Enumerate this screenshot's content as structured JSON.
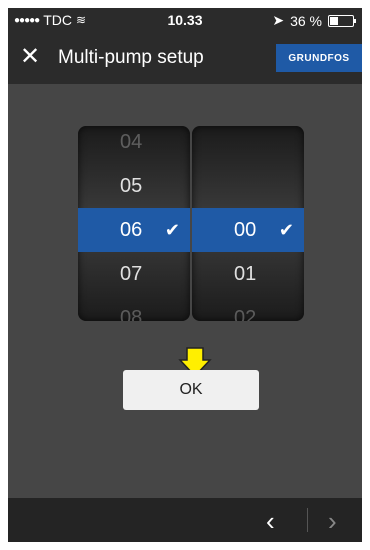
{
  "status_bar": {
    "carrier": "TDC",
    "time": "10.33",
    "battery": "36 %"
  },
  "header": {
    "close_icon": "close-icon",
    "title": "Multi-pump setup",
    "brand": "GRUNDFOS"
  },
  "picker": {
    "hours": [
      "04",
      "05",
      "06",
      "07",
      "08"
    ],
    "minutes": [
      "00",
      "01",
      "02"
    ],
    "selected_hour": "06",
    "selected_minute": "00"
  },
  "ok_label": "OK",
  "bottom_nav": {
    "prev_icon": "chevron-left-icon",
    "next_icon": "chevron-right-icon"
  }
}
